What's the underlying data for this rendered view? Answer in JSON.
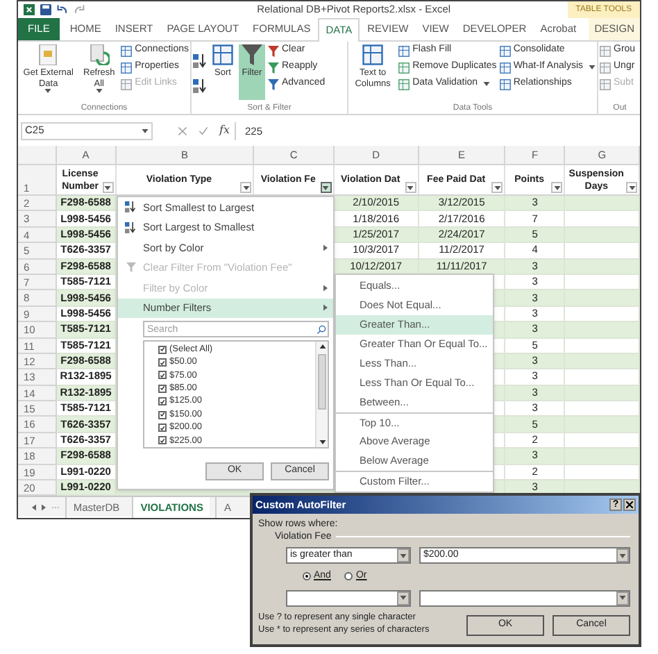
{
  "window": {
    "title": "Relational DB+Pivot Reports2.xlsx - Excel",
    "context_label": "TABLE TOOLS"
  },
  "tabs": [
    {
      "label": "FILE",
      "kind": "file",
      "selected": false
    },
    {
      "label": "HOME",
      "kind": "tab",
      "selected": false
    },
    {
      "label": "INSERT",
      "kind": "tab",
      "selected": false
    },
    {
      "label": "PAGE LAYOUT",
      "kind": "tab",
      "selected": false
    },
    {
      "label": "FORMULAS",
      "kind": "tab",
      "selected": false
    },
    {
      "label": "DATA",
      "kind": "tab",
      "selected": true
    },
    {
      "label": "REVIEW",
      "kind": "tab",
      "selected": false
    },
    {
      "label": "VIEW",
      "kind": "tab",
      "selected": false
    },
    {
      "label": "DEVELOPER",
      "kind": "tab",
      "selected": false
    },
    {
      "label": "Acrobat",
      "kind": "tab",
      "selected": false
    },
    {
      "label": "DESIGN",
      "kind": "context",
      "selected": false
    }
  ],
  "ribbon": {
    "groups": [
      {
        "label": "Connections",
        "buttons": [
          {
            "kind": "large",
            "label": "Get External Data",
            "menu": true,
            "disabled": false,
            "selected": false
          },
          {
            "kind": "large",
            "label": "Refresh All",
            "menu": true,
            "disabled": false,
            "selected": false
          },
          {
            "kind": "small",
            "label": "Connections",
            "menu": false,
            "disabled": false,
            "selected": false
          },
          {
            "kind": "small",
            "label": "Properties",
            "menu": false,
            "disabled": false,
            "selected": false
          },
          {
            "kind": "small",
            "label": "Edit Links",
            "menu": false,
            "disabled": true,
            "selected": false
          }
        ]
      },
      {
        "label": "Sort & Filter",
        "buttons": [
          {
            "kind": "icon",
            "menu": false,
            "disabled": false,
            "selected": false
          },
          {
            "kind": "icon",
            "menu": false,
            "disabled": false,
            "selected": false
          },
          {
            "kind": "large",
            "label": "Sort",
            "menu": false,
            "disabled": false,
            "selected": false
          },
          {
            "kind": "large",
            "label": "Filter",
            "menu": false,
            "disabled": false,
            "selected": true
          },
          {
            "kind": "small",
            "label": "Clear",
            "menu": false,
            "disabled": false,
            "selected": false
          },
          {
            "kind": "small",
            "label": "Reapply",
            "menu": false,
            "disabled": false,
            "selected": false
          },
          {
            "kind": "small",
            "label": "Advanced",
            "menu": false,
            "disabled": false,
            "selected": false
          }
        ]
      },
      {
        "label": "Data Tools",
        "buttons": [
          {
            "kind": "large",
            "label": "Text to Columns",
            "menu": false,
            "disabled": false,
            "selected": false
          },
          {
            "kind": "small",
            "label": "Flash Fill",
            "menu": false,
            "disabled": false,
            "selected": false
          },
          {
            "kind": "small",
            "label": "Remove Duplicates",
            "menu": false,
            "disabled": false,
            "selected": false
          },
          {
            "kind": "small",
            "label": "Data Validation",
            "menu": true,
            "disabled": false,
            "selected": false
          },
          {
            "kind": "small",
            "label": "Consolidate",
            "menu": false,
            "disabled": false,
            "selected": false
          },
          {
            "kind": "small",
            "label": "What-If Analysis",
            "menu": true,
            "disabled": false,
            "selected": false
          },
          {
            "kind": "small",
            "label": "Relationships",
            "menu": false,
            "disabled": false,
            "selected": false
          }
        ]
      },
      {
        "label": "Out",
        "buttons": [
          {
            "kind": "small",
            "label": "Grou",
            "menu": false,
            "disabled": false,
            "selected": false
          },
          {
            "kind": "small",
            "label": "Ungr",
            "menu": false,
            "disabled": false,
            "selected": false
          },
          {
            "kind": "small",
            "label": "Subt",
            "menu": false,
            "disabled": true,
            "selected": false
          }
        ]
      }
    ]
  },
  "formula_bar": {
    "name_box": "C25",
    "function_label": "fx",
    "value": "225"
  },
  "sheet": {
    "columns": [
      "A",
      "B",
      "C",
      "D",
      "E",
      "F",
      "G"
    ],
    "header_row_number": "1",
    "headers": [
      {
        "label": "License Number",
        "open": false
      },
      {
        "label": "Violation Type",
        "open": false
      },
      {
        "label": "Violation Fe",
        "open": true
      },
      {
        "label": "Violation Dat",
        "open": false
      },
      {
        "label": "Fee Paid Dat",
        "open": false
      },
      {
        "label": "Points",
        "open": false
      },
      {
        "label": "Suspension Days",
        "open": false
      }
    ],
    "rows": [
      {
        "number": "2",
        "license": "F298-6588",
        "violation_date": "2/10/2015",
        "fee_paid_date": "3/12/2015",
        "points": "3"
      },
      {
        "number": "3",
        "license": "L998-5456",
        "violation_date": "1/18/2016",
        "fee_paid_date": "2/17/2016",
        "points": "7"
      },
      {
        "number": "4",
        "license": "L998-5456",
        "violation_date": "1/25/2017",
        "fee_paid_date": "2/24/2017",
        "points": "5"
      },
      {
        "number": "5",
        "license": "T626-3357",
        "violation_date": "10/3/2017",
        "fee_paid_date": "11/2/2017",
        "points": "4"
      },
      {
        "number": "6",
        "license": "F298-6588",
        "violation_date": "10/12/2017",
        "fee_paid_date": "11/11/2017",
        "points": "3"
      },
      {
        "number": "7",
        "license": "T585-7121",
        "points": "3"
      },
      {
        "number": "8",
        "license": "L998-5456",
        "points": "3"
      },
      {
        "number": "9",
        "license": "L998-5456",
        "points": "3"
      },
      {
        "number": "10",
        "license": "T585-7121",
        "points": "3"
      },
      {
        "number": "11",
        "license": "T585-7121",
        "points": "5"
      },
      {
        "number": "12",
        "license": "F298-6588",
        "points": "3"
      },
      {
        "number": "13",
        "license": "R132-1895",
        "points": "3"
      },
      {
        "number": "14",
        "license": "R132-1895",
        "points": "3"
      },
      {
        "number": "15",
        "license": "T585-7121",
        "points": "3"
      },
      {
        "number": "16",
        "license": "T626-3357",
        "points": "5"
      },
      {
        "number": "17",
        "license": "T626-3357",
        "points": "2"
      },
      {
        "number": "18",
        "license": "F298-6588",
        "points": "3"
      },
      {
        "number": "19",
        "license": "L991-0220",
        "points": "2"
      },
      {
        "number": "20",
        "license": "L991-0220",
        "points": "3"
      }
    ]
  },
  "sheet_tabs": {
    "more": "...",
    "tabs": [
      {
        "label": "MasterDB",
        "selected": false
      },
      {
        "label": "VIOLATIONS",
        "selected": true
      },
      {
        "label": "A",
        "selected": false
      }
    ]
  },
  "filter_menu": {
    "items": [
      {
        "label": "Sort Smallest to Largest",
        "kind": "sort_asc",
        "disabled": false,
        "submenu": false,
        "highlighted": false
      },
      {
        "label": "Sort Largest to Smallest",
        "kind": "sort_desc",
        "disabled": false,
        "submenu": false,
        "highlighted": false
      },
      {
        "label": "Sort by Color",
        "kind": "plain",
        "disabled": false,
        "submenu": true,
        "highlighted": false
      },
      {
        "label": "Clear Filter From \"Violation Fee\"",
        "kind": "clear",
        "disabled": true,
        "submenu": false,
        "highlighted": false
      },
      {
        "label": "Filter by Color",
        "kind": "plain",
        "disabled": true,
        "submenu": true,
        "highlighted": false
      },
      {
        "label": "Number Filters",
        "kind": "plain",
        "disabled": false,
        "submenu": true,
        "highlighted": true
      }
    ],
    "search": {
      "placeholder": "Search"
    },
    "values": [
      {
        "label": "(Select All)",
        "checked": true
      },
      {
        "label": "$50.00",
        "checked": true
      },
      {
        "label": "$75.00",
        "checked": true
      },
      {
        "label": "$85.00",
        "checked": true
      },
      {
        "label": "$125.00",
        "checked": true
      },
      {
        "label": "$150.00",
        "checked": true
      },
      {
        "label": "$200.00",
        "checked": true
      },
      {
        "label": "$225.00",
        "checked": true
      }
    ],
    "buttons": [
      "OK",
      "Cancel"
    ]
  },
  "number_filters_menu": {
    "items": [
      {
        "label": "Equals...",
        "highlighted": false,
        "separator_before": false
      },
      {
        "label": "Does Not Equal...",
        "highlighted": false,
        "separator_before": false
      },
      {
        "label": "Greater Than...",
        "highlighted": true,
        "separator_before": false
      },
      {
        "label": "Greater Than Or Equal To...",
        "highlighted": false,
        "separator_before": false
      },
      {
        "label": "Less Than...",
        "highlighted": false,
        "separator_before": false
      },
      {
        "label": "Less Than Or Equal To...",
        "highlighted": false,
        "separator_before": false
      },
      {
        "label": "Between...",
        "highlighted": false,
        "separator_before": false
      },
      {
        "label": "Top 10...",
        "highlighted": false,
        "separator_before": true
      },
      {
        "label": "Above Average",
        "highlighted": false,
        "separator_before": false
      },
      {
        "label": "Below Average",
        "highlighted": false,
        "separator_before": false
      },
      {
        "label": "Custom Filter...",
        "highlighted": false,
        "separator_before": true
      }
    ]
  },
  "dialog": {
    "title": "Custom AutoFilter",
    "help_label": "?",
    "caption": "Show rows where:",
    "field": "Violation Fee",
    "condition": {
      "operator": "is greater than",
      "value": "$200.00"
    },
    "join": [
      {
        "label": "And",
        "selected": true
      },
      {
        "label": "Or",
        "selected": false
      }
    ],
    "hints": [
      "Use ? to represent any single character",
      "Use * to represent any series of characters"
    ],
    "buttons": [
      "OK",
      "Cancel"
    ]
  }
}
